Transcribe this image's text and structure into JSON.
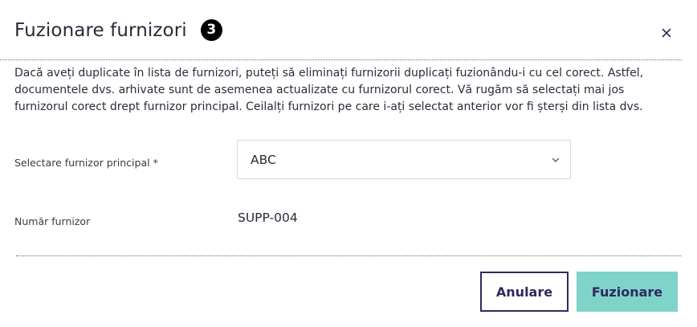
{
  "dialog": {
    "title": "Fuzionare furnizori",
    "badge_count": "3",
    "close_icon": "close-icon",
    "description": "Dacă aveți duplicate în lista de furnizori, puteți să eliminați furnizorii duplicați fuzionându-i cu cel corect. Astfel, documentele dvs. arhivate sunt de asemenea actualizate cu furnizorul corect. Vă rugăm să selectați mai jos furnizorul corect drept furnizor principal. Ceilalți furnizori pe care i-ați selectat anterior vor fi șterși din lista dvs."
  },
  "form": {
    "primary_supplier_label": "Selectare furnizor principal *",
    "primary_supplier_value": "ABC",
    "supplier_number_label": "Număr furnizor",
    "supplier_number_value": "SUPP-004"
  },
  "footer": {
    "cancel_label": "Anulare",
    "merge_label": "Fuzionare"
  },
  "colors": {
    "primary_button": "#7fd3c9",
    "brand_dark": "#2e2a5e"
  }
}
